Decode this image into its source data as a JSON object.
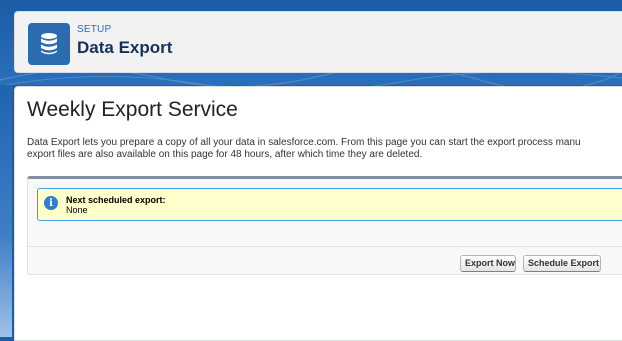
{
  "header": {
    "eyebrow": "SETUP",
    "title": "Data Export",
    "icon": "database-icon"
  },
  "main": {
    "title": "Weekly Export Service",
    "description_lines": [
      "Data Export lets you prepare a copy of all your data in salesforce.com. From this page you can start the export process manu",
      "export files are also available on this page for 48 hours, after which time they are deleted."
    ],
    "info": {
      "icon": "info-icon",
      "label": "Next scheduled export:",
      "value": "None"
    },
    "buttons": {
      "export_now": "Export Now",
      "schedule_export": "Schedule Export"
    }
  },
  "colors": {
    "background": "#1b5fa8",
    "accent": "#2b6cb0",
    "info_background": "#ffffcc",
    "info_border": "#3b9fe4"
  }
}
